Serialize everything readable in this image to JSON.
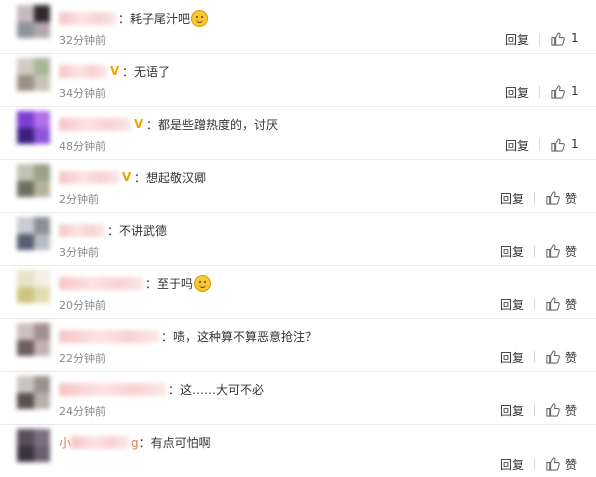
{
  "colors": {
    "nickname": "#eb7350",
    "time": "#888888",
    "text": "#333333",
    "vip": "#f2a200"
  },
  "comments": [
    {
      "nickname": "",
      "nickname_tail": "",
      "vip": false,
      "colon": "：",
      "text": "耗子尾汁吧",
      "emoji": "smile-emoji",
      "time": "32分钟前",
      "reply": "回复",
      "like": "1"
    },
    {
      "nickname": "",
      "nickname_tail": "",
      "vip": true,
      "colon": "：",
      "text": "无语了",
      "emoji": "",
      "time": "34分钟前",
      "reply": "回复",
      "like": "1"
    },
    {
      "nickname": "",
      "nickname_tail": "",
      "vip": true,
      "colon": "：",
      "text": "都是些蹭热度的，讨厌",
      "emoji": "",
      "time": "48分钟前",
      "reply": "回复",
      "like": "1"
    },
    {
      "nickname": "",
      "nickname_tail": "",
      "vip": true,
      "colon": "：",
      "text": "想起敬汉卿",
      "emoji": "",
      "time": "2分钟前",
      "reply": "回复",
      "like": "赞"
    },
    {
      "nickname": "",
      "nickname_tail": "",
      "vip": false,
      "colon": "：",
      "text": "不讲武德",
      "emoji": "",
      "time": "3分钟前",
      "reply": "回复",
      "like": "赞"
    },
    {
      "nickname": "",
      "nickname_tail": "",
      "vip": false,
      "colon": "：",
      "text": "至于吗",
      "emoji": "hmm-emoji",
      "time": "20分钟前",
      "reply": "回复",
      "like": "赞"
    },
    {
      "nickname": "",
      "nickname_tail": "",
      "vip": false,
      "colon": "：",
      "text": "啧，这种算不算恶意抢注？",
      "emoji": "",
      "time": "22分钟前",
      "reply": "回复",
      "like": "赞"
    },
    {
      "nickname": "",
      "nickname_tail": "",
      "vip": false,
      "colon": "：",
      "text": "这……大可不必",
      "emoji": "",
      "time": "24分钟前",
      "reply": "回复",
      "like": "赞"
    },
    {
      "nickname": "小",
      "nickname_tail": "g",
      "vip": false,
      "colon": "：",
      "text": "有点可怕啊",
      "emoji": "",
      "time": "",
      "reply": "回复",
      "like": "赞"
    }
  ]
}
